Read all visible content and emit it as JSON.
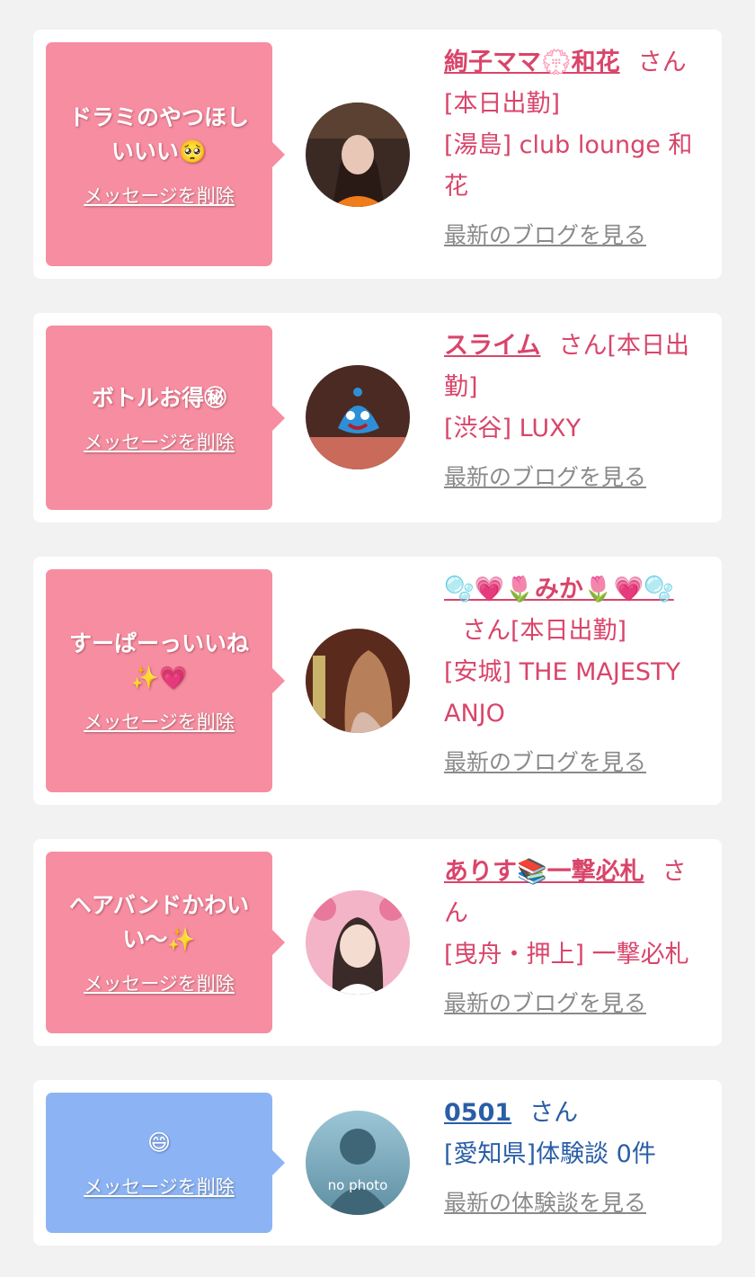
{
  "cards": [
    {
      "message": "ドラミのやつほしいいい🥺",
      "delete_label": "メッセージを削除",
      "name": "絢子ママ💮和花",
      "honorific": "さん",
      "status": "[本日出勤]",
      "location": "[湯島] club lounge 和花",
      "link": "最新のブログを見る"
    },
    {
      "message": "ボトルお得㊙",
      "delete_label": "メッセージを削除",
      "name": "スライム",
      "honorific": "さん[本日出勤]",
      "location": "[渋谷] LUXY",
      "link": "最新のブログを見る"
    },
    {
      "message": "すーぱーっいいね✨💗",
      "delete_label": "メッセージを削除",
      "name": "🫧💗🌷みか🌷💗🫧",
      "honorific": "さん[本日出勤]",
      "location": "[安城] THE MAJESTY ANJO",
      "link": "最新のブログを見る"
    },
    {
      "message": "ヘアバンドかわいい〜✨",
      "delete_label": "メッセージを削除",
      "name": "ありす📚一撃必札",
      "honorific": "さん",
      "location": "[曳舟・押上] 一撃必札",
      "link": "最新のブログを見る"
    },
    {
      "message": "😄",
      "delete_label": "メッセージを削除",
      "name": "0501",
      "honorific": "さん",
      "location": "[愛知県]体験談 0件",
      "link": "最新の体験談を見る",
      "avatar_text": "no photo"
    }
  ],
  "colors": {
    "pink_bubble": "#f78da0",
    "blue_bubble": "#8cb4f5",
    "pink_text": "#d9456a",
    "blue_text": "#2a5ea6",
    "link_gray": "#8a8a8a"
  }
}
